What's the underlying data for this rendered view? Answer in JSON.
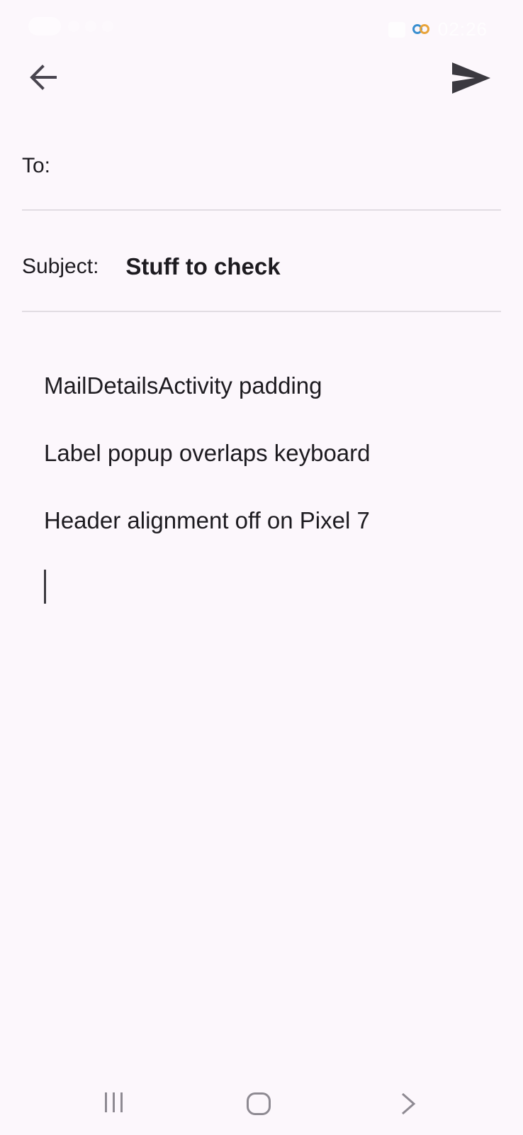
{
  "status_bar": {
    "time": "02:26",
    "icons": [
      "volte-icon",
      "signal-icon",
      "wifi-icon",
      "notification-icon",
      "battery-icon",
      "app-rings-icon"
    ]
  },
  "toolbar": {
    "back_icon": "arrow-left-icon",
    "send_icon": "send-icon"
  },
  "compose": {
    "to_label": "To:",
    "to_value": "",
    "subject_label": "Subject:",
    "subject_value": "Stuff to check",
    "body_lines": [
      "MailDetailsActivity padding",
      "Label popup overlaps keyboard",
      "Header alignment off on Pixel 7"
    ]
  },
  "nav_bar": {
    "recents_icon": "recents-icon",
    "home_icon": "home-icon",
    "back_icon": "chevron-right-icon"
  },
  "colors": {
    "background": "#fcf7fc",
    "text": "#1d1b20",
    "divider": "#e2dde3",
    "icon": "#49454f"
  }
}
